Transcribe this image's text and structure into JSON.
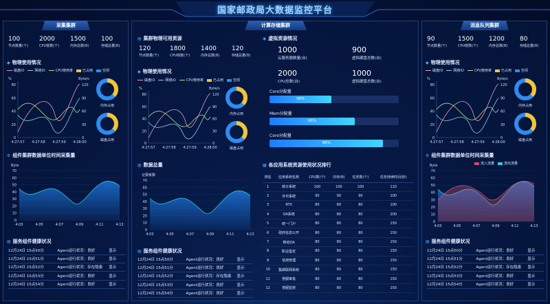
{
  "title": "国家邮政局大数据监控平台",
  "panels": {
    "left": "采集集群",
    "center": "计算存储集群",
    "right": "消息队列集群"
  },
  "left": {
    "stats": [
      {
        "value": "100",
        "label": "节点数量(个)"
      },
      {
        "value": "2000",
        "label": "CPU核数(个)"
      },
      {
        "value": "1500",
        "label": "内存总数(B)"
      },
      {
        "value": "100",
        "label": "存储总量(B)"
      }
    ],
    "physical_title": "物理使用情况",
    "legend": [
      "磁盘IO",
      "网络IO",
      "CPU使用率",
      "已占用",
      "空闲"
    ],
    "y_left_unit": "%",
    "y_right_unit": "Byte/s",
    "y_left_ticks": [
      "80",
      "60",
      "40",
      "20",
      "0"
    ],
    "y_right_ticks": [
      "120",
      "90",
      "60",
      "30",
      "0"
    ],
    "x_ticks": [
      "4:27:57",
      "4:27:58",
      "4:27:59",
      "4:28:00"
    ],
    "ring_labels": [
      "内存占用",
      "磁盘占用"
    ],
    "collect_title": "组件集群数据单位时间采集量",
    "collect_unit": "Byte",
    "collect_y_ticks": [
      "70",
      "60",
      "50",
      "40",
      "30",
      "20",
      "10",
      "0"
    ],
    "collect_x_ticks": [
      "4:03",
      "4:05",
      "4:07",
      "4:09",
      "4:11",
      "4:13"
    ],
    "health_title": "服务组件健康状况",
    "health_rows": [
      {
        "time": "12月24日 15点50分",
        "status": "Agent运行状况：良好",
        "action": "显示"
      },
      {
        "time": "12月24日 15点51分",
        "status": "Agent运行状况：良好",
        "action": "显示"
      },
      {
        "time": "12月24日 15点52分",
        "status": "Agent运行状况：存在隐患",
        "action": "显示"
      },
      {
        "time": "12月24日 15点53分",
        "status": "Agent运行状况：良好",
        "action": "显示"
      },
      {
        "time": "12月24日 15点54分",
        "status": "Agent运行状况：良好",
        "action": "显示"
      }
    ]
  },
  "center": {
    "cluster_title": "集群物理可用资源",
    "stats": [
      {
        "value": "120",
        "label": "节点数量(个)"
      },
      {
        "value": "1800",
        "label": "CPU核数(个)"
      },
      {
        "value": "1400",
        "label": "内存总数(B)"
      },
      {
        "value": "120",
        "label": "存储总量(B)"
      }
    ],
    "physical_title": "物理使用情况",
    "legend": [
      "磁盘IO",
      "网络IO",
      "CPU使用率",
      "已占用",
      "空闲"
    ],
    "y_left_unit": "%",
    "y_right_unit": "Byte/s",
    "y_left_ticks": [
      "80",
      "60",
      "40",
      "20",
      "0"
    ],
    "y_right_ticks": [
      "120",
      "90",
      "60",
      "30",
      "0"
    ],
    "x_ticks": [
      "4:27:57",
      "4:27:58",
      "4:27:59",
      "4:28:00"
    ],
    "ring_labels": [
      "内存占用",
      "磁盘占用"
    ],
    "data_title": "数据总量",
    "data_unit": "记录条数",
    "data_y_ticks": [
      "70",
      "60",
      "50",
      "40",
      "30",
      "20",
      "10",
      "0"
    ],
    "data_x_ticks": [
      "4:03",
      "4:05",
      "4:07",
      "4:09",
      "4:11",
      "4:13"
    ],
    "health_title": "服务组件健康状况",
    "health_rows": [
      {
        "time": "12月24日 15点50分",
        "status": "Agent运行状况：良好",
        "action": "显示"
      },
      {
        "time": "12月24日 15点51分",
        "status": "Agent运行状况：良好",
        "action": "显示"
      },
      {
        "time": "12月24日 15点52分",
        "status": "Agent运行状况：存在隐患",
        "action": "显示"
      },
      {
        "time": "12月24日 15点53分",
        "status": "Agent运行状况：良好",
        "action": "显示"
      },
      {
        "time": "12月24日 15点54分",
        "status": "Agent运行状况：良好",
        "action": "显示"
      }
    ],
    "virtual_title": "虚拟资源情况",
    "virtual_stats": [
      {
        "value": "1000",
        "label": "云服务器数量(台)"
      },
      {
        "value": "900",
        "label": "虚拟硬盘总数(台)"
      },
      {
        "value": "2000",
        "label": "CPU总数(台)"
      },
      {
        "value": "1000",
        "label": "虚拟硬盘总数(台)"
      }
    ],
    "bars": [
      {
        "label": "Core分配量",
        "percent": 48,
        "text": "48%"
      },
      {
        "label": "Mem分配量",
        "percent": 66,
        "text": "66%"
      },
      {
        "label": "Core分配量",
        "percent": 88,
        "text": "88%"
      }
    ],
    "rank_title": "各应用系统资源使用状况排行",
    "rank_headers": [
      "排名",
      "应用系统名称",
      "CPU数(个)",
      "内存(B)",
      "任务数(个)",
      "任务持续时间(秒)"
    ],
    "rank_rows": [
      [
        "1",
        "统计系统",
        "100",
        "100",
        "100",
        "110"
      ],
      [
        "2",
        "许可系统",
        "90",
        "90",
        "90",
        "100"
      ],
      [
        "3",
        "RTX",
        "80",
        "80",
        "80",
        "100"
      ],
      [
        "4",
        "OA系统",
        "80",
        "80",
        "80",
        "200"
      ],
      [
        "5",
        "统一门户",
        "80",
        "80",
        "80",
        "150"
      ],
      [
        "6",
        "政府信息公开",
        "80",
        "80",
        "80",
        "150"
      ],
      [
        "7",
        "移动OA",
        "80",
        "80",
        "80",
        "150"
      ],
      [
        "8",
        "职业鉴定",
        "80",
        "80",
        "80",
        "150"
      ],
      [
        "9",
        "信用管理",
        "80",
        "80",
        "80",
        "150"
      ],
      [
        "10",
        "集邮联网系统",
        "80",
        "80",
        "80",
        "150"
      ],
      [
        "11",
        "普服审批",
        "80",
        "80",
        "80",
        "150"
      ],
      [
        "12",
        "普服监管",
        "80",
        "80",
        "80",
        "150"
      ]
    ]
  },
  "right": {
    "stats": [
      {
        "value": "90",
        "label": "节点数量(个)"
      },
      {
        "value": "1500",
        "label": "CPU核数(个)"
      },
      {
        "value": "1200",
        "label": "内存总数(B)"
      },
      {
        "value": "80",
        "label": "存储总量(B)"
      }
    ],
    "physical_title": "物理使用情况",
    "legend": [
      "磁盘IO",
      "网络IO",
      "CPU使用率",
      "已占用",
      "空闲"
    ],
    "y_left_unit": "%",
    "y_right_unit": "Byte/s",
    "y_left_ticks": [
      "80",
      "60",
      "40",
      "20",
      "0"
    ],
    "y_right_ticks": [
      "120",
      "90",
      "60",
      "30",
      "0"
    ],
    "x_ticks": [
      "4:27:57",
      "4:27:58",
      "4:27:59",
      "4:28:00"
    ],
    "ring_labels": [
      "内存占用",
      "磁盘占用"
    ],
    "collect_title": "组件集群数据单位时间采集量",
    "collect_unit": "Byte",
    "collect_legend": [
      "流入流量",
      "流出流量"
    ],
    "collect_y_ticks": [
      "70",
      "60",
      "50",
      "40",
      "30",
      "20",
      "10",
      "0"
    ],
    "collect_x_ticks": [
      "4:03",
      "4:05",
      "4:07",
      "4:09",
      "4:11",
      "4:13"
    ],
    "health_title": "服务组件健康状况",
    "health_rows": [
      {
        "time": "12月24日 15点50分",
        "status": "Agent运行状况：良好",
        "action": "显示"
      },
      {
        "time": "12月24日 15点51分",
        "status": "Agent运行状况：良好",
        "action": "显示"
      },
      {
        "time": "12月24日 15点52分",
        "status": "Agent运行状况：存在隐患",
        "action": "显示"
      },
      {
        "time": "12月24日 15点53分",
        "status": "Agent运行状况：良好",
        "action": "显示"
      },
      {
        "time": "12月24日 15点54分",
        "status": "Agent运行状况：良好",
        "action": "显示"
      }
    ]
  },
  "colors": {
    "accent": "#3fa9ff",
    "disk_io": "#e8a0b8",
    "net_io": "#8fd0e8",
    "cpu": "#b8e07a",
    "used": "#f2c438",
    "free": "#2f8bf0",
    "area": "#1a6fd0",
    "flow_in": "#c8506a",
    "flow_out": "#35c8e6"
  }
}
